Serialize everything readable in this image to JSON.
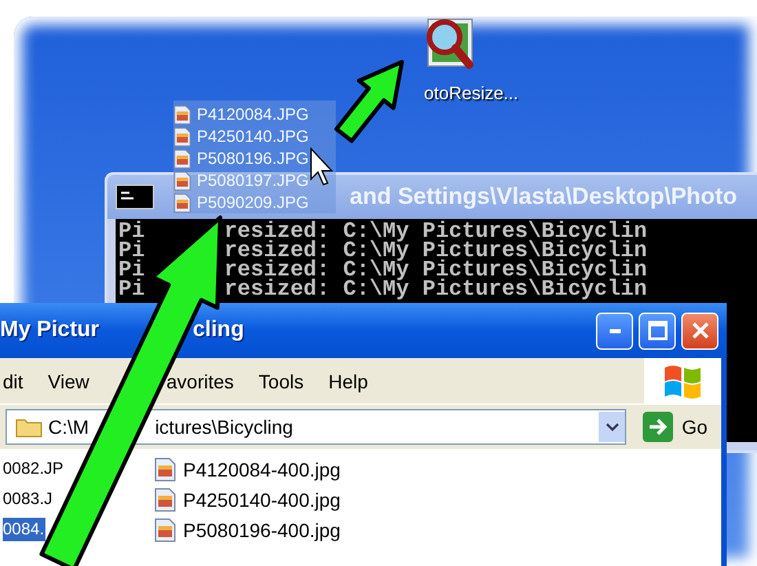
{
  "desktop_icon": {
    "label": "otoResize..."
  },
  "dragged_files": [
    {
      "name": "P4120084.JPG"
    },
    {
      "name": "P4250140.JPG"
    },
    {
      "name": "P5080196.JPG"
    },
    {
      "name": "P5080197.JPG"
    },
    {
      "name": "P5090209.JPG"
    }
  ],
  "console_window": {
    "title": "and Settings\\Vlasta\\Desktop\\Photo",
    "lines": [
      {
        "parts": [
          "Pi",
          "resized: C:\\My Pictures\\Bicyclin"
        ]
      },
      {
        "parts": [
          "Pi",
          "resized: C:\\My Pictures\\Bicyclin"
        ]
      },
      {
        "parts": [
          "Pi",
          "resized: C:\\My Pictures\\Bicyclin"
        ]
      },
      {
        "parts": [
          "Pi",
          "resized: C:\\My Pictures\\Bicyclin"
        ]
      }
    ]
  },
  "explorer_window": {
    "title_parts": [
      "My Pictur",
      "cling"
    ],
    "menu": [
      "dit",
      "View",
      "avorites",
      "Tools",
      "Help"
    ],
    "address_parts": [
      "C:\\M",
      "ictures\\Bicycling"
    ],
    "go_label": "Go",
    "files_left": [
      {
        "name": "0082.JP",
        "selected": false
      },
      {
        "name": "0083.J",
        "selected": false
      },
      {
        "name": "0084.",
        "selected": true
      }
    ],
    "files_right": [
      {
        "name": "P4120084-400.jpg"
      },
      {
        "name": "P4250140-400.jpg"
      },
      {
        "name": "P5080196-400.jpg"
      }
    ]
  }
}
